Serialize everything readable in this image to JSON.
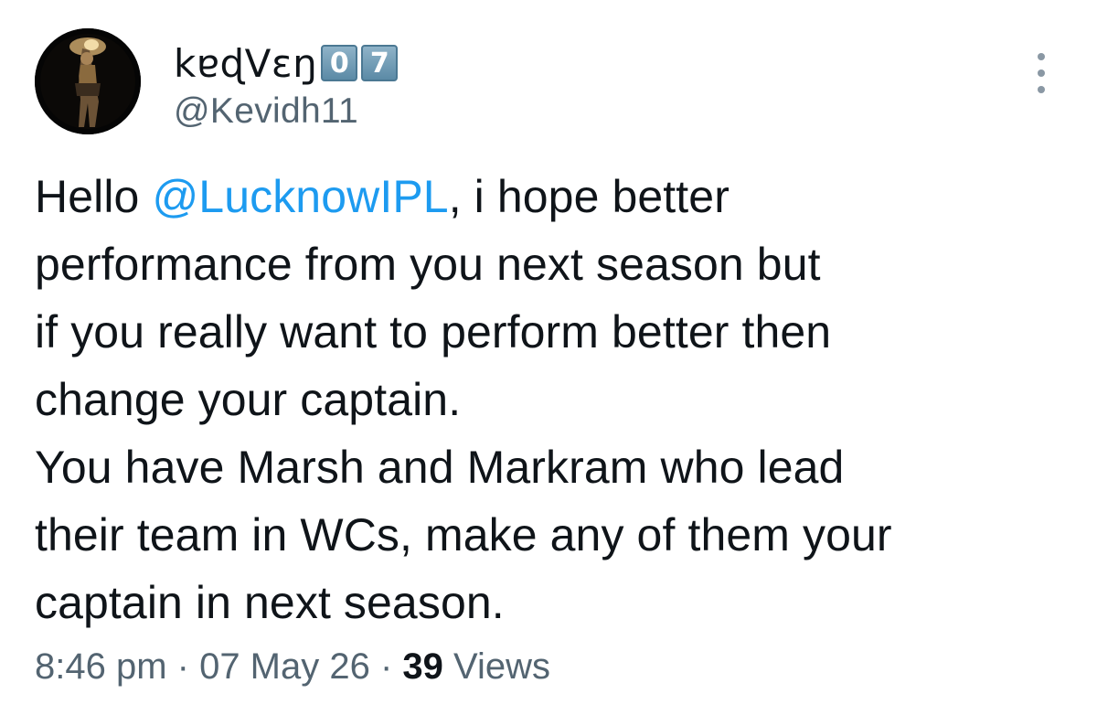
{
  "author": {
    "display_name": "kɐɖVɛŋ",
    "badge_digits": [
      "0",
      "7"
    ],
    "handle": "@Kevidh11",
    "avatar_icon": "avatar-icon"
  },
  "more_menu": {
    "icon": "more-vertical-icon"
  },
  "tweet": {
    "line1_prefix": "Hello ",
    "mention": "@LucknowIPL",
    "line1_suffix": ", i hope better",
    "line2": "performance from you next season but",
    "line3": "if you really want to perform better then",
    "line4": "change your captain.",
    "line5": "You have Marsh and Markram who lead",
    "line6": "their team in WCs, make any of them your",
    "line7": "captain in next season."
  },
  "meta": {
    "time": "8:46 pm",
    "separator": " · ",
    "date": "07 May 26",
    "views_count": "39",
    "views_label": " Views"
  },
  "colors": {
    "link": "#1d9bf0",
    "secondary_text": "#536471",
    "primary_text": "#0f1419"
  }
}
